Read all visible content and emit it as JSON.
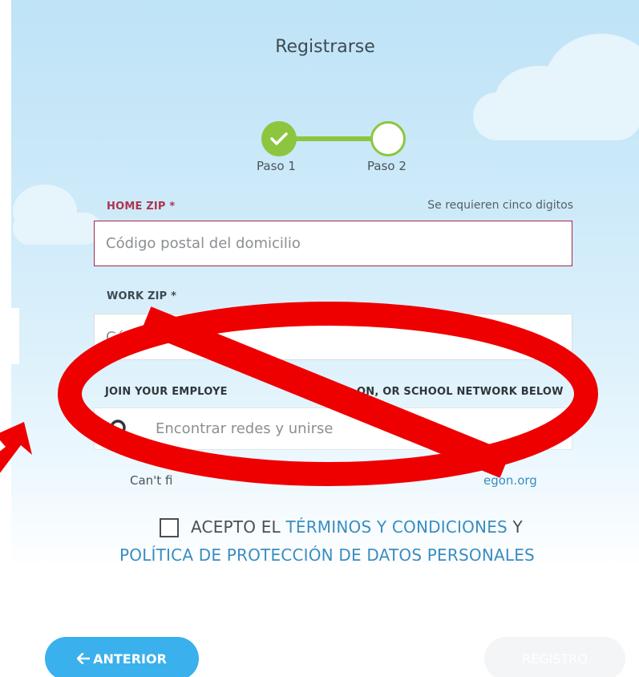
{
  "header": {
    "title": "Registrarse"
  },
  "steps": [
    {
      "label": "Paso 1"
    },
    {
      "label": "Paso 2"
    }
  ],
  "form": {
    "home_zip": {
      "label": "HOME ZIP",
      "required_mark": "*",
      "hint": "Se requieren cinco digitos",
      "placeholder": "Código postal del domicilio"
    },
    "work_zip": {
      "label": "WORK ZIP",
      "required_mark": "*",
      "placeholder_visible": "Códi"
    },
    "network": {
      "label": "JOIN YOUR EMPLOYER, ORGANIZATION, OR SCHOOL NETWORK BELOW",
      "label_left": "JOIN YOUR EMPLOYE",
      "label_right": "ON, OR SCHOOL NETWORK BELOW",
      "placeholder": "Encontrar redes y unirse"
    },
    "help_left": "Can't fi",
    "help_link": "egon.org"
  },
  "terms": {
    "line1_prefix": "ACEPTO EL ",
    "terms_link": "TÉRMINOS Y CONDICIONES",
    "line1_suffix": " Y",
    "privacy_link": "POLÍTICA DE PROTECCIÓN DE DATOS PERSONALES"
  },
  "buttons": {
    "back": "ANTERIOR",
    "register": "REGISTRO"
  },
  "icons": {
    "step_done": "check-icon",
    "back_arrow": "arrow-left-icon",
    "search": "search-icon",
    "overlay": "prohibition-icon",
    "pointer": "arrow-icon"
  },
  "colors": {
    "accent_green": "#8cc63f",
    "required_red": "#b0344f",
    "link_blue": "#3a8dc0",
    "button_blue": "#3ab0ec",
    "overlay_red": "#ee0000"
  }
}
